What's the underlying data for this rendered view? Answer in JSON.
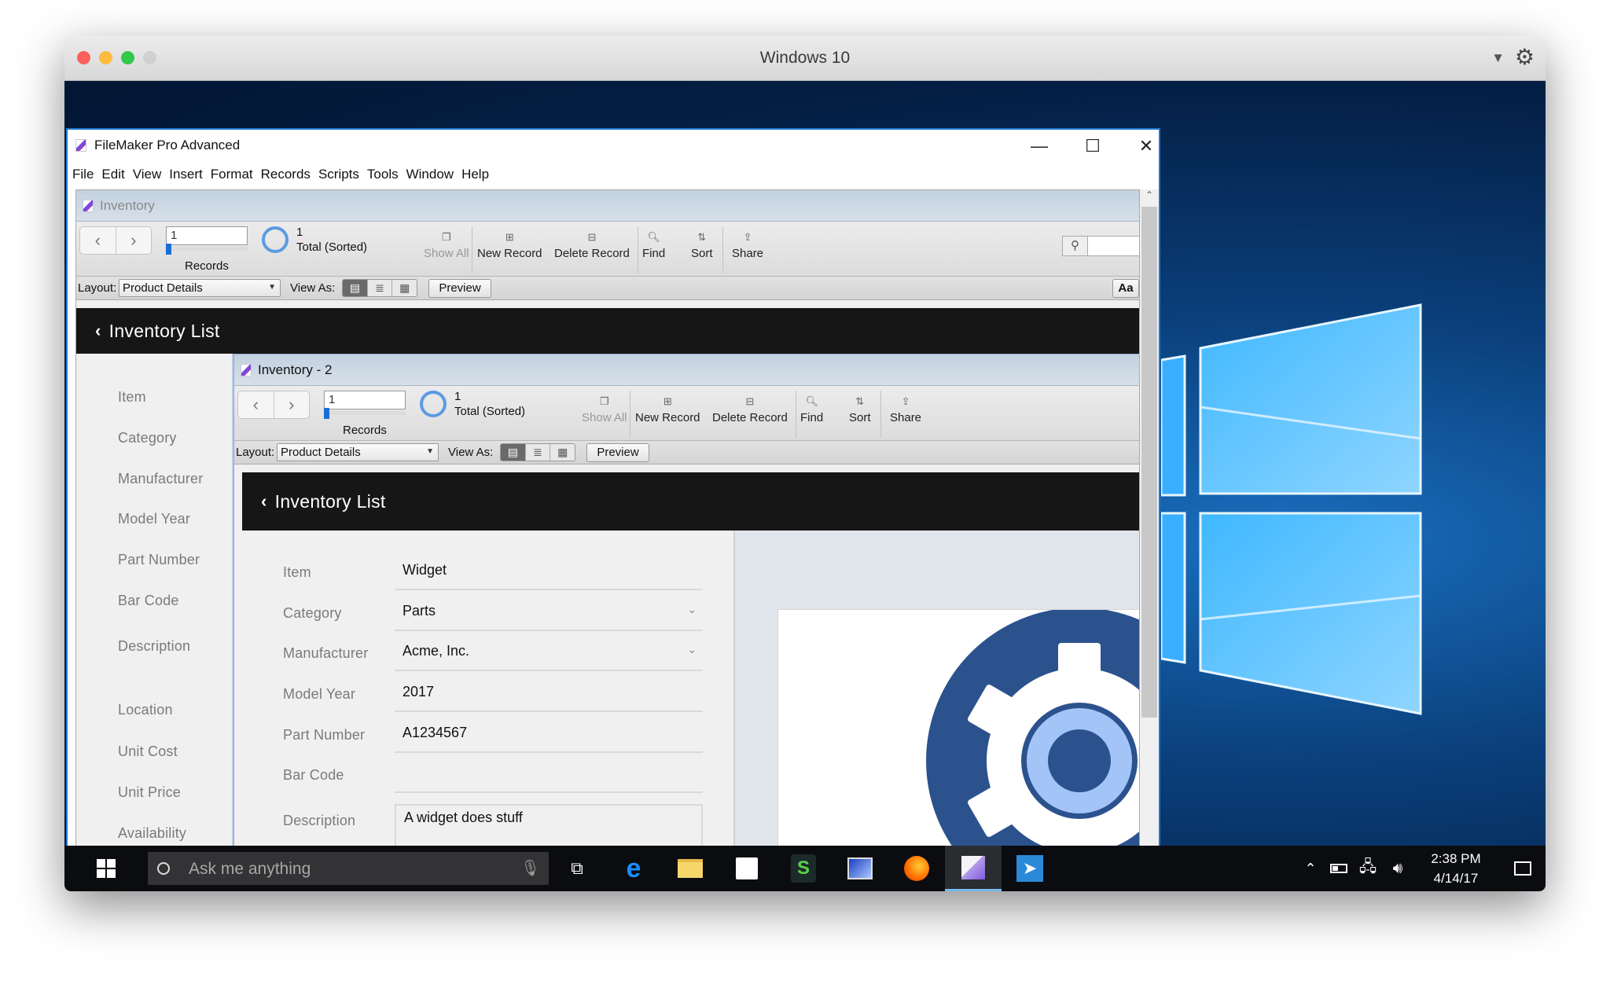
{
  "host_window": {
    "title": "Windows 10",
    "traffic_lights": {
      "close": "#fc605c",
      "minimize": "#fdbc40",
      "zoom": "#34c84a",
      "disabled": "#d0d0d0"
    },
    "menu_arrow_icon": "▼",
    "gear_icon": "⚙"
  },
  "app": {
    "title": "FileMaker Pro Advanced",
    "window_controls": {
      "minimize": "—",
      "maximize": "☐",
      "close": "✕"
    },
    "menu": [
      "File",
      "Edit",
      "View",
      "Insert",
      "Format",
      "Records",
      "Scripts",
      "Tools",
      "Window",
      "Help"
    ]
  },
  "doc1": {
    "title": "Inventory",
    "record_number": "1",
    "records_label": "Records",
    "found_count": "1",
    "found_status": "Total (Sorted)",
    "toolbar": {
      "show_all": "Show All",
      "new_record": "New Record",
      "delete_record": "Delete Record",
      "find": "Find",
      "sort": "Sort",
      "share": "Share"
    },
    "layout_label": "Layout:",
    "layout_value": "Product Details",
    "view_as_label": "View As:",
    "preview_label": "Preview",
    "text_format_label": "Aa",
    "header_title": "Inventory List",
    "labels": [
      "Item",
      "Category",
      "Manufacturer",
      "Model Year",
      "Part Number",
      "Bar Code",
      "Description",
      "Location",
      "Unit Cost",
      "Unit Price",
      "Availability"
    ]
  },
  "doc2": {
    "title": "Inventory - 2",
    "record_number": "1",
    "records_label": "Records",
    "found_count": "1",
    "found_status": "Total (Sorted)",
    "toolbar": {
      "show_all": "Show All",
      "new_record": "New Record",
      "delete_record": "Delete Record",
      "find": "Find",
      "sort": "Sort",
      "share": "Share"
    },
    "layout_label": "Layout:",
    "layout_value": "Product Details",
    "view_as_label": "View As:",
    "preview_label": "Preview",
    "header_title": "Inventory List",
    "fields": [
      {
        "label": "Item",
        "value": "Widget",
        "dropdown": false
      },
      {
        "label": "Category",
        "value": "Parts",
        "dropdown": true
      },
      {
        "label": "Manufacturer",
        "value": "Acme, Inc.",
        "dropdown": true
      },
      {
        "label": "Model Year",
        "value": "2017",
        "dropdown": false
      },
      {
        "label": "Part Number",
        "value": "A1234567",
        "dropdown": false
      },
      {
        "label": "Bar Code",
        "value": "",
        "dropdown": false
      }
    ],
    "description_label": "Description",
    "description_value": "A widget does stuff",
    "image_colors": {
      "dark": "#2c528e",
      "light": "#a3c4f7"
    }
  },
  "taskbar": {
    "search_placeholder": "Ask me anything",
    "clock_time": "2:38 PM",
    "clock_date": "4/14/17",
    "apps": [
      "edge",
      "file-explorer",
      "store",
      "app-green",
      "remote-desktop",
      "firefox",
      "filemaker",
      "app-blue"
    ],
    "active_app": "filemaker"
  }
}
